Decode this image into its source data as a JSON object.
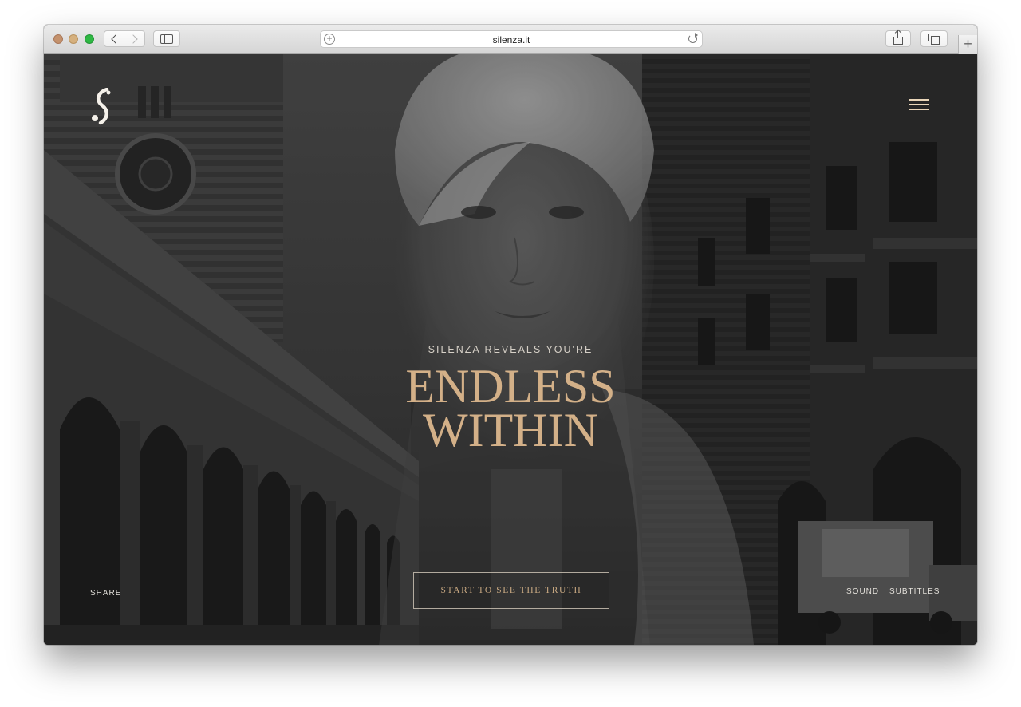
{
  "browser": {
    "url": "silenza.it",
    "new_tab_symbol": "+",
    "address_plus_symbol": "+"
  },
  "site": {
    "kicker": "SILENZA REVEALS YOU'RE",
    "headline_line1": "ENDLESS",
    "headline_line2": "WITHIN",
    "cta_label": "START TO SEE THE TRUTH",
    "share_label": "SHARE",
    "sound_label": "SOUND",
    "subtitles_label": "SUBTITLES"
  },
  "colors": {
    "accent_gold": "#d3b088",
    "menu_cream": "#ead6b9",
    "text_light": "#e3e0da"
  }
}
